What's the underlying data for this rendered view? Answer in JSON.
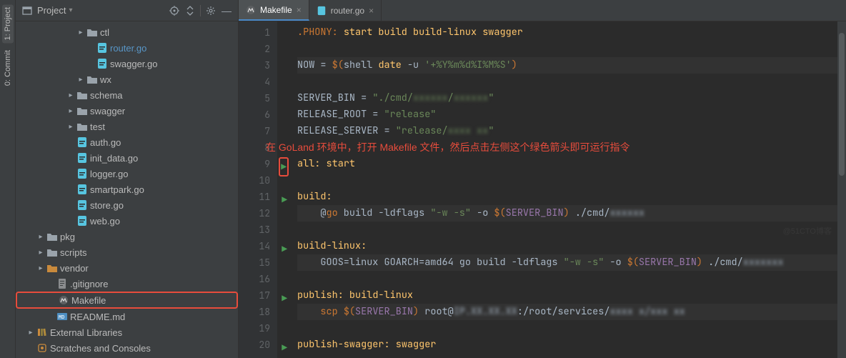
{
  "rail": {
    "items": [
      "1: Project",
      "0: Commit"
    ]
  },
  "project_panel": {
    "title": "Project"
  },
  "tree": {
    "items": [
      {
        "type": "folder",
        "label": "ctl",
        "indent": 6,
        "arrow": "▸"
      },
      {
        "type": "go",
        "label": "router.go",
        "indent": 7,
        "selectedTree": true
      },
      {
        "type": "go",
        "label": "swagger.go",
        "indent": 7
      },
      {
        "type": "folder",
        "label": "wx",
        "indent": 6,
        "arrow": "▸"
      },
      {
        "type": "folder",
        "label": "schema",
        "indent": 5,
        "arrow": "▸"
      },
      {
        "type": "folder",
        "label": "swagger",
        "indent": 5,
        "arrow": "▸"
      },
      {
        "type": "folder",
        "label": "test",
        "indent": 5,
        "arrow": "▸"
      },
      {
        "type": "go",
        "label": "auth.go",
        "indent": 5
      },
      {
        "type": "go",
        "label": "init_data.go",
        "indent": 5
      },
      {
        "type": "go",
        "label": "logger.go",
        "indent": 5
      },
      {
        "type": "go",
        "label": "smartpark.go",
        "indent": 5
      },
      {
        "type": "go",
        "label": "store.go",
        "indent": 5
      },
      {
        "type": "go",
        "label": "web.go",
        "indent": 5
      },
      {
        "type": "folder",
        "label": "pkg",
        "indent": 2,
        "arrow": "▸"
      },
      {
        "type": "folder",
        "label": "scripts",
        "indent": 2,
        "arrow": "▸"
      },
      {
        "type": "folder-orange",
        "label": "vendor",
        "indent": 2,
        "arrow": "▸"
      },
      {
        "type": "gitignore",
        "label": ".gitignore",
        "indent": 3
      },
      {
        "type": "mk",
        "label": "Makefile",
        "indent": 3,
        "highlighted": true
      },
      {
        "type": "md",
        "label": "README.md",
        "indent": 3
      },
      {
        "type": "lib",
        "label": "External Libraries",
        "indent": 1,
        "arrow": "▸"
      },
      {
        "type": "scratch",
        "label": "Scratches and Consoles",
        "indent": 1
      }
    ]
  },
  "tabs": [
    {
      "label": "Makefile",
      "icon": "makefile",
      "active": true
    },
    {
      "label": "router.go",
      "icon": "go",
      "active": false
    }
  ],
  "annotation": "在 GoLand 环境中，打开 Makefile 文件，然后点击左侧这个绿色箭头即可运行指令",
  "code": {
    "lines": [
      {
        "n": 1,
        "html": "<span class='kw'>.PHONY:</span> <span class='tgt'>start build build-linux swagger</span>"
      },
      {
        "n": 2,
        "html": ""
      },
      {
        "n": 3,
        "html": "<span>NOW</span> <span>=</span> <span class='kw'>$(</span><span>shell</span> <span class='tgt'>date</span> -u <span class='str'>'+%Y%m%d%I%M%S'</span><span class='kw'>)</span>",
        "hl": true
      },
      {
        "n": 4,
        "html": ""
      },
      {
        "n": 5,
        "html": "SERVER_BIN = <span class='str'>\"./cmd/</span><span class='str blur'>xxxxxx</span><span class='str'>/</span><span class='str blur'>xxxxxx</span><span class='str'>\"</span>"
      },
      {
        "n": 6,
        "html": "RELEASE_ROOT = <span class='str'>\"release\"</span>"
      },
      {
        "n": 7,
        "html": "RELEASE_SERVER = <span class='str'>\"release/</span><span class='str blur'>xxxx xx</span><span class='str'>\"</span>"
      },
      {
        "n": 8,
        "html": "<span class='annotation' data-name='annotation-text' data-interactable='false'></span>",
        "special": "annotation"
      },
      {
        "n": 9,
        "html": "<span class='tgt'>all:</span> <span class='tgt'>start</span>",
        "run": true,
        "boxed": true
      },
      {
        "n": 10,
        "html": ""
      },
      {
        "n": 11,
        "html": "<span class='tgt'>build:</span>",
        "run": true
      },
      {
        "n": 12,
        "html": "    @<span class='kw'>go</span> build -ldflags <span class='str'>\"-w -s\"</span> -o <span class='kw'>$(</span><span class='var'>SERVER_BIN</span><span class='kw'>)</span> ./cmd/<span class='blur'>xxxxxx</span>",
        "hl": true
      },
      {
        "n": 13,
        "html": ""
      },
      {
        "n": 14,
        "html": "<span class='tgt'>build-linux:</span>",
        "run": true
      },
      {
        "n": 15,
        "html": "    GOOS=linux GOARCH=amd64 go build -ldflags <span class='str'>\"-w -s\"</span> -o <span class='kw'>$(</span><span class='var'>SERVER_BIN</span><span class='kw'>)</span> ./cmd/<span class='blur'>xxxxxxx</span>",
        "hl": true
      },
      {
        "n": 16,
        "html": ""
      },
      {
        "n": 17,
        "html": "<span class='tgt'>publish:</span> <span class='tgt'>build-linux</span>",
        "run": true
      },
      {
        "n": 18,
        "html": "    <span class='kw'>scp</span> <span class='kw'>$(</span><span class='var'>SERVER_BIN</span><span class='kw'>)</span> root@<span class='blur'>IP.XX.XX.XX</span>:/root/services/<span class='blur'>xxxx x/xxx xx</span>",
        "hl": true
      },
      {
        "n": 19,
        "html": ""
      },
      {
        "n": 20,
        "html": "<span class='tgt'>publish-swagger:</span> <span class='tgt'>swagger</span>",
        "run": true
      }
    ]
  }
}
